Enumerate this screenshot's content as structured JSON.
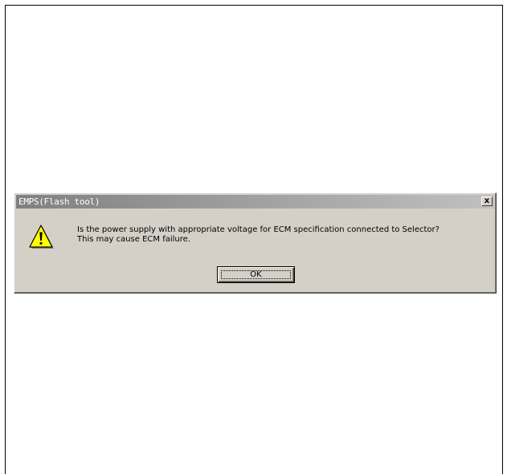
{
  "dialog": {
    "title": "EMPS(Flash tool)",
    "close_label": "x",
    "icon": "warning-icon",
    "message_line1": "Is the power supply with appropriate voltage for ECM specification connected to Selector?",
    "message_line2": "This may cause ECM failure.",
    "ok_label": "OK"
  },
  "colors": {
    "dialog_background": "#d4d0c8",
    "titlebar_start": "#808080",
    "titlebar_end": "#c0c0c0",
    "title_text": "#ffffff"
  }
}
